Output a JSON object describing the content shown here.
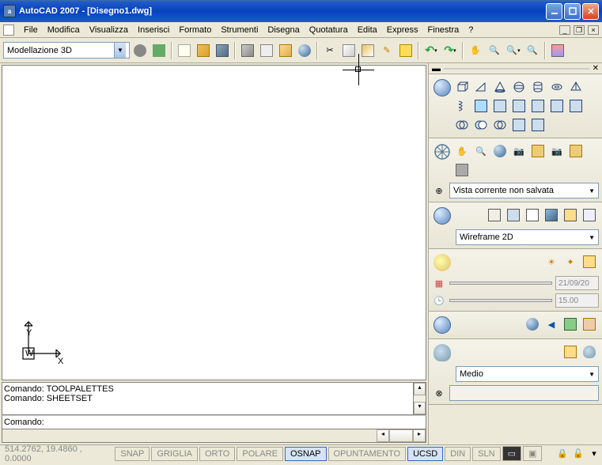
{
  "title": "AutoCAD 2007 - [Disegno1.dwg]",
  "menu": [
    "File",
    "Modifica",
    "Visualizza",
    "Inserisci",
    "Formato",
    "Strumenti",
    "Disegna",
    "Quotatura",
    "Edita",
    "Express",
    "Finestra",
    "?"
  ],
  "workspace": {
    "selected": "Modellazione 3D"
  },
  "cmd": {
    "line1": "Comando: TOOLPALETTES",
    "line2": "Comando: SHEETSET",
    "line3": "",
    "prompt": "Comando:"
  },
  "rightPanel": {
    "viewCombo": "Vista corrente non salvata",
    "visualStyleCombo": "Wireframe 2D",
    "renderCombo": "Medio",
    "dateField": "21/09/20",
    "timeField": "15.00"
  },
  "status": {
    "coords": "514.2762, 19.4860 , 0.0000",
    "toggles": [
      "SNAP",
      "GRIGLIA",
      "ORTO",
      "POLARE",
      "OSNAP",
      "OPUNTAMENTO",
      "UCSD",
      "DIN",
      "SLN"
    ]
  }
}
